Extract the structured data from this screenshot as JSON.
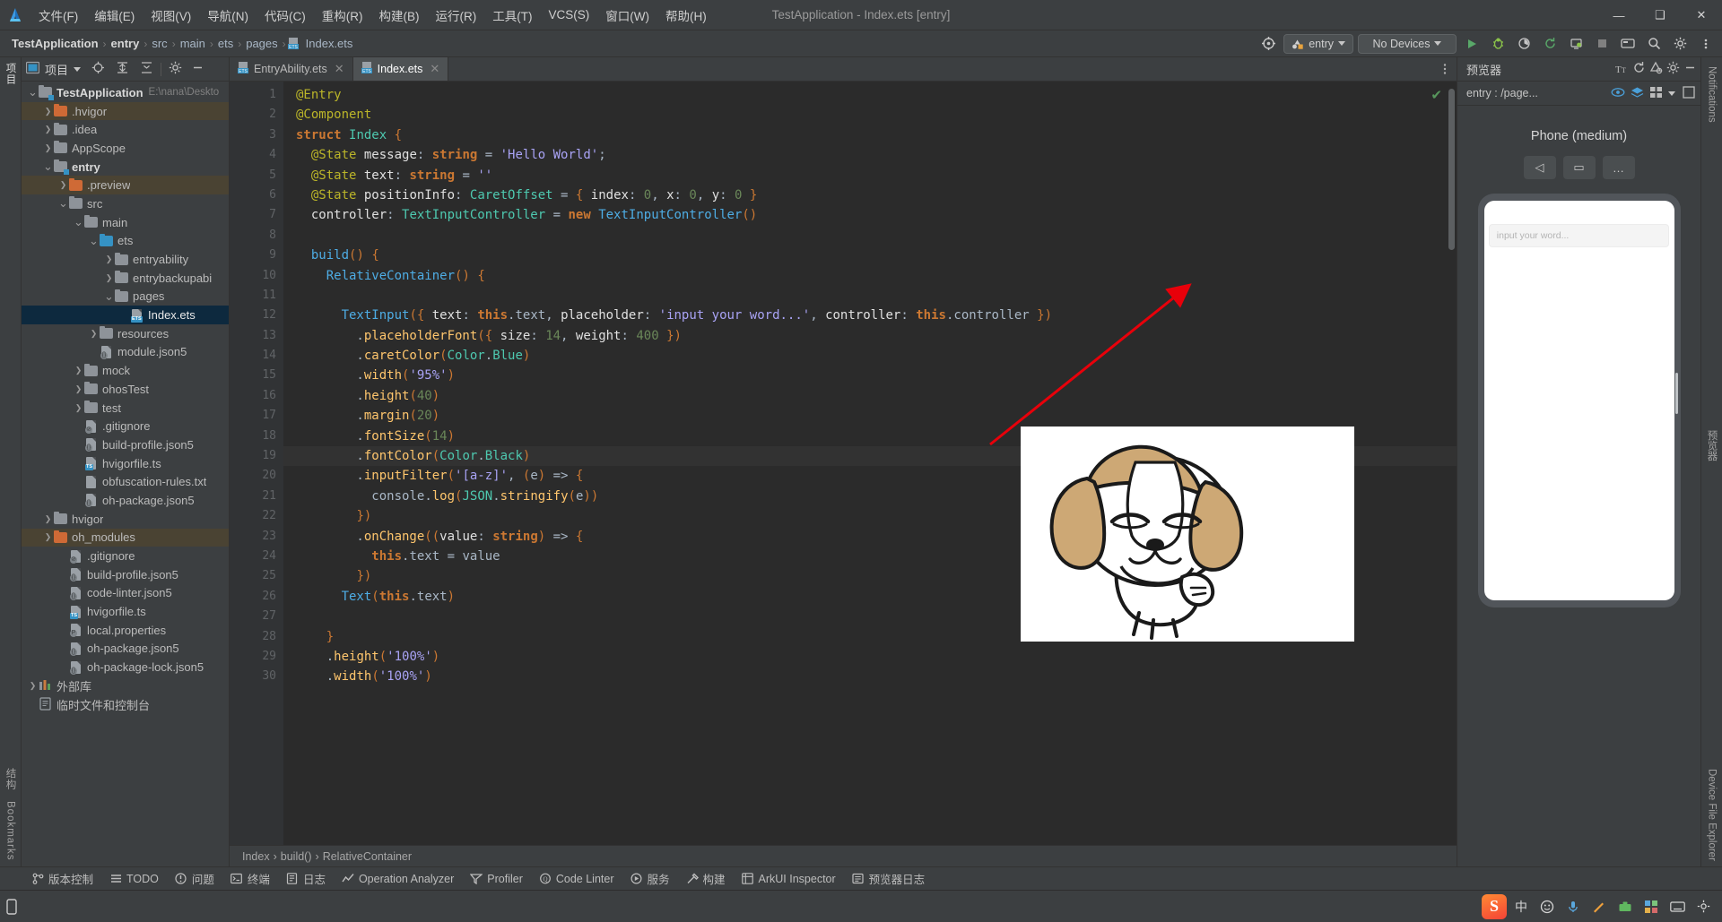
{
  "window": {
    "title": "TestApplication - Index.ets [entry]",
    "minimize": "—",
    "maximize": "❑",
    "close": "✕"
  },
  "menu": {
    "items": [
      {
        "label": "文件(F)",
        "name": "menu-file"
      },
      {
        "label": "编辑(E)",
        "name": "menu-edit"
      },
      {
        "label": "视图(V)",
        "name": "menu-view"
      },
      {
        "label": "导航(N)",
        "name": "menu-navigate"
      },
      {
        "label": "代码(C)",
        "name": "menu-code"
      },
      {
        "label": "重构(R)",
        "name": "menu-refactor"
      },
      {
        "label": "构建(B)",
        "name": "menu-build"
      },
      {
        "label": "运行(R)",
        "name": "menu-run"
      },
      {
        "label": "工具(T)",
        "name": "menu-tools"
      },
      {
        "label": "VCS(S)",
        "name": "menu-vcs"
      },
      {
        "label": "窗口(W)",
        "name": "menu-window"
      },
      {
        "label": "帮助(H)",
        "name": "menu-help"
      }
    ]
  },
  "breadcrumb": {
    "items": [
      "TestApplication",
      "entry",
      "src",
      "main",
      "ets",
      "pages",
      "Index.ets"
    ],
    "separator": "›"
  },
  "toolbar": {
    "module_chip": "entry",
    "device_chip": "No Devices",
    "run_icon": "▶",
    "debug_icon": "debug-icon",
    "profile_icon": "profile-icon",
    "sync_icon": "sync-icon",
    "attach_icon": "attach-icon",
    "stop_icon": "stop-icon",
    "device_manager_icon": "device-manager-icon",
    "search_icon": "⚲",
    "settings_icon": "gear-icon",
    "notifications_icon": "bell-icon",
    "target_icon": "target-icon"
  },
  "project_panel": {
    "title": "项目",
    "tree": [
      {
        "label": "TestApplication",
        "path": "E:\\nana\\Deskto",
        "depth": 0,
        "arrow": "down",
        "icon": "folder-module",
        "bold": true,
        "state": ""
      },
      {
        "label": ".hvigor",
        "depth": 1,
        "arrow": "right",
        "icon": "folder-orange",
        "state": "mod"
      },
      {
        "label": ".idea",
        "depth": 1,
        "arrow": "right",
        "icon": "folder-gray",
        "state": ""
      },
      {
        "label": "AppScope",
        "depth": 1,
        "arrow": "right",
        "icon": "folder-gray",
        "state": ""
      },
      {
        "label": "entry",
        "depth": 1,
        "arrow": "down",
        "icon": "folder-module",
        "bold": true,
        "state": ""
      },
      {
        "label": ".preview",
        "depth": 2,
        "arrow": "right",
        "icon": "folder-orange",
        "state": "mod"
      },
      {
        "label": "src",
        "depth": 2,
        "arrow": "down",
        "icon": "folder-gray",
        "state": ""
      },
      {
        "label": "main",
        "depth": 3,
        "arrow": "down",
        "icon": "folder-gray",
        "state": ""
      },
      {
        "label": "ets",
        "depth": 4,
        "arrow": "down",
        "icon": "folder-blue",
        "state": ""
      },
      {
        "label": "entryability",
        "depth": 5,
        "arrow": "right",
        "icon": "folder-gray",
        "state": ""
      },
      {
        "label": "entrybackupabi",
        "depth": 5,
        "arrow": "right",
        "icon": "folder-gray",
        "state": ""
      },
      {
        "label": "pages",
        "depth": 5,
        "arrow": "down",
        "icon": "folder-gray",
        "state": ""
      },
      {
        "label": "Index.ets",
        "depth": 6,
        "arrow": "none",
        "icon": "file-ets",
        "state": "sel"
      },
      {
        "label": "resources",
        "depth": 4,
        "arrow": "right",
        "icon": "folder-gray",
        "state": ""
      },
      {
        "label": "module.json5",
        "depth": 4,
        "arrow": "none",
        "icon": "file-json5",
        "state": ""
      },
      {
        "label": "mock",
        "depth": 3,
        "arrow": "right",
        "icon": "folder-gray",
        "state": ""
      },
      {
        "label": "ohosTest",
        "depth": 3,
        "arrow": "right",
        "icon": "folder-gray",
        "state": ""
      },
      {
        "label": "test",
        "depth": 3,
        "arrow": "right",
        "icon": "folder-gray",
        "state": ""
      },
      {
        "label": ".gitignore",
        "depth": 3,
        "arrow": "none",
        "icon": "file-git",
        "state": ""
      },
      {
        "label": "build-profile.json5",
        "depth": 3,
        "arrow": "none",
        "icon": "file-json5",
        "state": ""
      },
      {
        "label": "hvigorfile.ts",
        "depth": 3,
        "arrow": "none",
        "icon": "file-ts",
        "state": ""
      },
      {
        "label": "obfuscation-rules.txt",
        "depth": 3,
        "arrow": "none",
        "icon": "file-txt",
        "state": ""
      },
      {
        "label": "oh-package.json5",
        "depth": 3,
        "arrow": "none",
        "icon": "file-json5",
        "state": ""
      },
      {
        "label": "hvigor",
        "depth": 1,
        "arrow": "right",
        "icon": "folder-gray",
        "state": ""
      },
      {
        "label": "oh_modules",
        "depth": 1,
        "arrow": "right",
        "icon": "folder-orange",
        "state": "mod"
      },
      {
        "label": ".gitignore",
        "depth": 2,
        "arrow": "none",
        "icon": "file-git",
        "state": ""
      },
      {
        "label": "build-profile.json5",
        "depth": 2,
        "arrow": "none",
        "icon": "file-json5",
        "state": ""
      },
      {
        "label": "code-linter.json5",
        "depth": 2,
        "arrow": "none",
        "icon": "file-json5",
        "state": ""
      },
      {
        "label": "hvigorfile.ts",
        "depth": 2,
        "arrow": "none",
        "icon": "file-ts",
        "state": ""
      },
      {
        "label": "local.properties",
        "depth": 2,
        "arrow": "none",
        "icon": "file-props",
        "state": ""
      },
      {
        "label": "oh-package.json5",
        "depth": 2,
        "arrow": "none",
        "icon": "file-json5",
        "state": ""
      },
      {
        "label": "oh-package-lock.json5",
        "depth": 2,
        "arrow": "none",
        "icon": "file-json5",
        "state": ""
      },
      {
        "label": "外部库",
        "depth": 0,
        "arrow": "right",
        "icon": "lib",
        "state": ""
      },
      {
        "label": "临时文件和控制台",
        "depth": 0,
        "arrow": "none",
        "icon": "scratch",
        "state": ""
      }
    ]
  },
  "left_rail": {
    "items": [
      "项目"
    ]
  },
  "left_rail_bottom": {
    "items": [
      "结构",
      "Bookmarks"
    ]
  },
  "right_rail": {
    "items": [
      "Notifications",
      "预览器",
      "Device File Explorer"
    ]
  },
  "editor": {
    "tabs": [
      {
        "label": "EntryAbility.ets",
        "active": false,
        "icon": "file-ets"
      },
      {
        "label": "Index.ets",
        "active": true,
        "icon": "file-ets"
      }
    ],
    "lines": [
      {
        "n": 1,
        "text": "@Entry"
      },
      {
        "n": 2,
        "text": "@Component"
      },
      {
        "n": 3,
        "text": "struct Index {"
      },
      {
        "n": 4,
        "text": "  @State message: string = 'Hello World';"
      },
      {
        "n": 5,
        "text": "  @State text: string = ''"
      },
      {
        "n": 6,
        "text": "  @State positionInfo: CaretOffset = { index: 0, x: 0, y: 0 }"
      },
      {
        "n": 7,
        "text": "  controller: TextInputController = new TextInputController()"
      },
      {
        "n": 8,
        "text": ""
      },
      {
        "n": 9,
        "text": "  build() {"
      },
      {
        "n": 10,
        "text": "    RelativeContainer() {"
      },
      {
        "n": 11,
        "text": ""
      },
      {
        "n": 12,
        "text": "      TextInput({ text: this.text, placeholder: 'input your word...', controller: this.controller })"
      },
      {
        "n": 13,
        "text": "        .placeholderFont({ size: 14, weight: 400 })"
      },
      {
        "n": 14,
        "text": "        .caretColor(Color.Blue)"
      },
      {
        "n": 15,
        "text": "        .width('95%')"
      },
      {
        "n": 16,
        "text": "        .height(40)"
      },
      {
        "n": 17,
        "text": "        .margin(20)"
      },
      {
        "n": 18,
        "text": "        .fontSize(14)"
      },
      {
        "n": 19,
        "text": "        .fontColor(Color.Black)"
      },
      {
        "n": 20,
        "text": "        .inputFilter('[a-z]', (e) => {"
      },
      {
        "n": 21,
        "text": "          console.log(JSON.stringify(e))"
      },
      {
        "n": 22,
        "text": "        })"
      },
      {
        "n": 23,
        "text": "        .onChange((value: string) => {"
      },
      {
        "n": 24,
        "text": "          this.text = value"
      },
      {
        "n": 25,
        "text": "        })"
      },
      {
        "n": 26,
        "text": "      Text(this.text)"
      },
      {
        "n": 27,
        "text": ""
      },
      {
        "n": 28,
        "text": "    }"
      },
      {
        "n": 29,
        "text": "    .height('100%')"
      },
      {
        "n": 30,
        "text": "    .width('100%')"
      }
    ],
    "caret_line": 19,
    "bulb_line": 19,
    "inspection_status": "✔",
    "bottom_breadcrumb": [
      "Index",
      "build()",
      "RelativeContainer"
    ],
    "bottom_breadcrumb_sep": "›"
  },
  "previewer": {
    "title": "预览器",
    "page_label": "entry : /page...",
    "device_name": "Phone (medium)",
    "controls": [
      "◁",
      "▭",
      "…"
    ],
    "phone": {
      "input_placeholder": "input your word..."
    },
    "header_icons": [
      "font-size-icon",
      "refresh-icon",
      "inspector-icon",
      "gear-icon",
      "minimize-icon"
    ],
    "sub_icons": [
      "eye-icon",
      "layers-icon",
      "grid-icon",
      "chevron-down-icon",
      "frame-icon"
    ]
  },
  "status_bar": {
    "items": [
      {
        "label": "版本控制",
        "icon": "branch-icon"
      },
      {
        "label": "TODO",
        "icon": "list-icon"
      },
      {
        "label": "问题",
        "icon": "warning-icon"
      },
      {
        "label": "终端",
        "icon": "terminal-icon"
      },
      {
        "label": "日志",
        "icon": "log-icon"
      },
      {
        "label": "Operation Analyzer",
        "icon": "chart-icon"
      },
      {
        "label": "Profiler",
        "icon": "profiler-icon"
      },
      {
        "label": "Code Linter",
        "icon": "linter-icon"
      },
      {
        "label": "服务",
        "icon": "services-icon"
      },
      {
        "label": "构建",
        "icon": "hammer-icon"
      },
      {
        "label": "ArkUI Inspector",
        "icon": "inspector-icon"
      },
      {
        "label": "预览器日志",
        "icon": "preview-log-icon"
      }
    ]
  },
  "taskbar": {
    "ime_badge": "S",
    "items": [
      "中",
      "☺",
      "⌨",
      "✎",
      "☰",
      "⊞",
      "⎙",
      "⚙"
    ]
  },
  "colors": {
    "accent": "#3592c4",
    "bg": "#3c3f41",
    "editor_bg": "#2b2b2b",
    "selection": "#0d293e",
    "modified": "#4a4333",
    "arrow": "#e8000a"
  }
}
